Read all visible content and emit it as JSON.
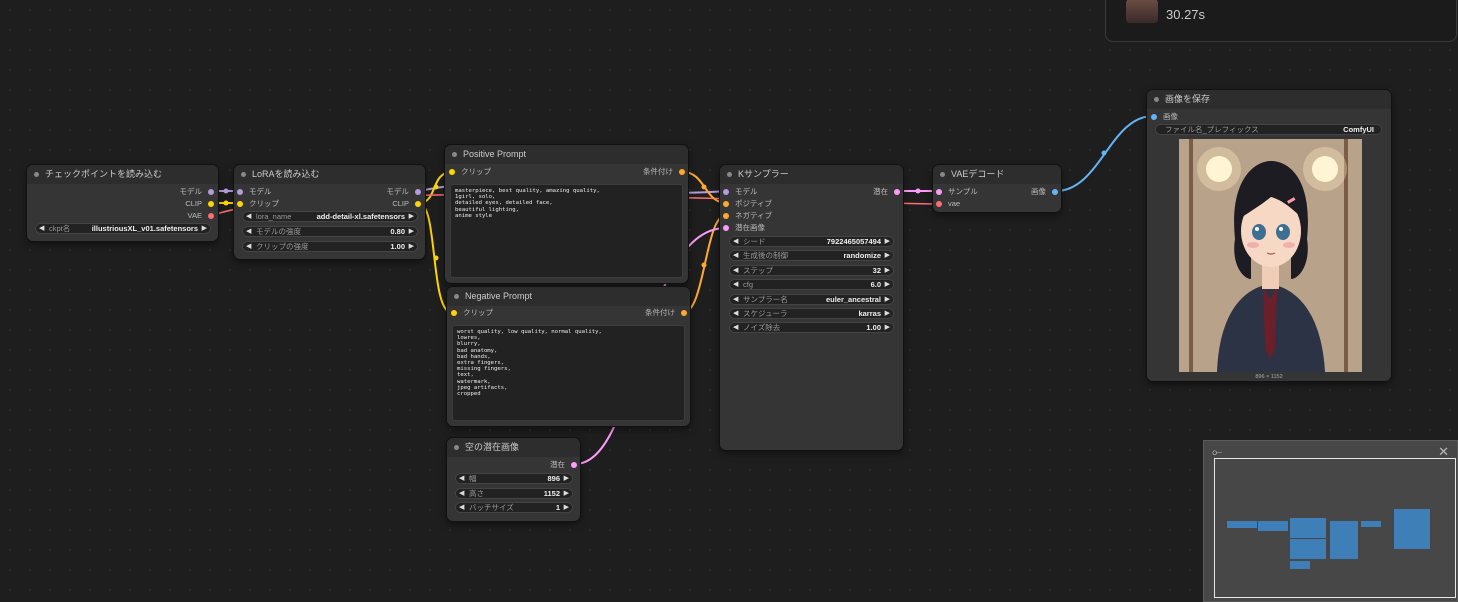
{
  "queue_panel": {
    "time": "30.27s"
  },
  "nodes": {
    "checkpoint": {
      "title": "チェックポイントを読み込む",
      "outputs": [
        "モデル",
        "CLIP",
        "VAE"
      ],
      "widgets": [
        {
          "label": "ckpt名",
          "value": "illustriousXL_v01.safetensors"
        }
      ]
    },
    "lora": {
      "title": "LoRAを読み込む",
      "inputs": [
        "モデル",
        "クリップ"
      ],
      "outputs": [
        "モデル",
        "CLIP"
      ],
      "widgets": [
        {
          "label": "lora_name",
          "value": "add-detail-xl.safetensors"
        },
        {
          "label": "モデルの強度",
          "value": "0.80"
        },
        {
          "label": "クリップの強度",
          "value": "1.00"
        }
      ]
    },
    "positive": {
      "title": "Positive Prompt",
      "input": "クリップ",
      "output": "条件付け",
      "text": "masterpiece, best quality, amazing quality,\n1girl, solo,\ndetailed eyes, detailed face,\nbeautiful lighting,\nanime style"
    },
    "negative": {
      "title": "Negative Prompt",
      "input": "クリップ",
      "output": "条件付け",
      "text": "worst quality, low quality, normal quality,\nlowres,\nblurry,\nbad anatomy,\nbad hands,\nextra fingers,\nmissing fingers,\ntext,\nwatermark,\njpeg artifacts,\ncropped"
    },
    "empty_latent": {
      "title": "空の潜在画像",
      "output": "潜在",
      "widgets": [
        {
          "label": "幅",
          "value": "896"
        },
        {
          "label": "高さ",
          "value": "1152"
        },
        {
          "label": "バッチサイズ",
          "value": "1"
        }
      ]
    },
    "ksampler": {
      "title": "Kサンプラー",
      "inputs": [
        "モデル",
        "ポジティブ",
        "ネガティブ",
        "潜在画像"
      ],
      "output": "潜在",
      "widgets": [
        {
          "label": "シード",
          "value": "792246505749​4"
        },
        {
          "label": "生成後の制御",
          "value": "randomize"
        },
        {
          "label": "ステップ",
          "value": "32"
        },
        {
          "label": "cfg",
          "value": "6.0"
        },
        {
          "label": "サンプラー名",
          "value": "euler_ancestral"
        },
        {
          "label": "スケジューラ",
          "value": "karras"
        },
        {
          "label": "ノイズ除去",
          "value": "1.00"
        }
      ]
    },
    "vae_decode": {
      "title": "VAEデコード",
      "inputs": [
        "サンプル",
        "vae"
      ],
      "output": "画像"
    },
    "save_image": {
      "title": "画像を保存",
      "input": "画像",
      "widgets": [
        {
          "label": "ファイル名_プレフィックス",
          "value": "ComfyUI"
        }
      ],
      "caption": "896 × 1152"
    }
  },
  "slot_colors": {
    "model": "#b39ddb",
    "clip": "#ffd500",
    "vae": "#ff6e6e",
    "conditioning": "#ffa931",
    "latent": "#ff9cf9",
    "image": "#64b5f6"
  },
  "icons": {
    "minimap_settings": "sliders-icon",
    "minimap_close": "close-icon"
  }
}
